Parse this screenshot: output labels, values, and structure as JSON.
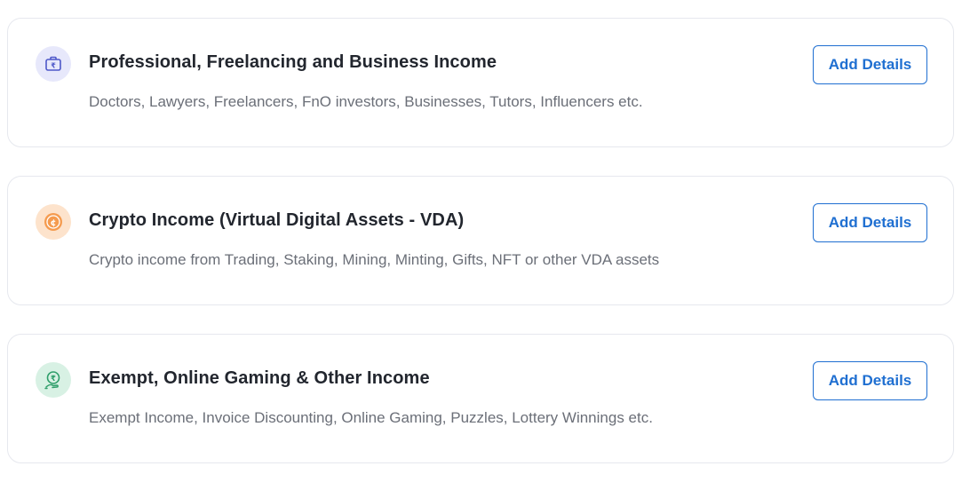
{
  "colors": {
    "accent": "#1f6fd1",
    "card_border": "#e6e8ee",
    "title_text": "#22262e",
    "desc_text": "#6b6f78",
    "icon_bg_purple": "#e7e8fb",
    "icon_bg_orange": "#fde3cc",
    "icon_bg_green": "#d8f1e4"
  },
  "cards": [
    {
      "icon": "briefcase-rupee-icon",
      "title": "Professional, Freelancing and Business Income",
      "description": "Doctors, Lawyers, Freelancers, FnO investors, Businesses, Tutors, Influencers etc.",
      "button_label": "Add Details"
    },
    {
      "icon": "crypto-coin-icon",
      "title": "Crypto Income (Virtual Digital Assets - VDA)",
      "description": "Crypto income from Trading, Staking, Mining, Minting, Gifts, NFT or other VDA assets",
      "button_label": "Add Details"
    },
    {
      "icon": "money-bag-rupee-icon",
      "title": "Exempt, Online Gaming & Other Income",
      "description": "Exempt Income, Invoice Discounting, Online Gaming, Puzzles, Lottery Winnings etc.",
      "button_label": "Add Details"
    }
  ]
}
